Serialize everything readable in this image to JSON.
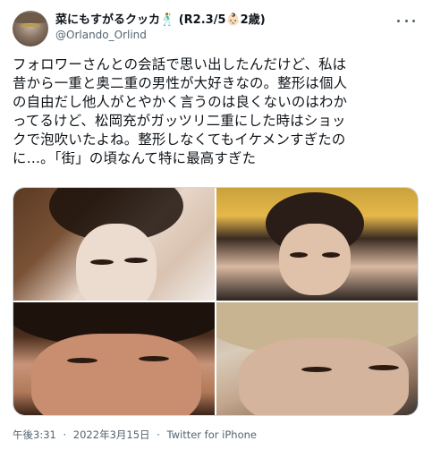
{
  "author": {
    "display_name": "菜にもすがるクッカ🕺 (R2.3/5👶🏻2歳)",
    "handle": "@Orlando_Orlind"
  },
  "tweet": {
    "text": "フォロワーさんとの会話で思い出したんだけど、私は\n昔から一重と奥二重の男性が大好きなの。整形は個人\nの自由だし他人がとやかく言うのは良くないのはわか\nってるけど、松岡充がガッツリ二重にした時はショッ\nクで泡吹いたよね。整形しなくてもイケメンすぎたの\nに…。「街」の頃なんて特に最高すぎた"
  },
  "meta": {
    "time": "午後3:31",
    "date": "2022年3月15日",
    "separator": "·",
    "source": "Twitter for iPhone"
  },
  "icons": {
    "more": "more-horizontal-icon"
  }
}
